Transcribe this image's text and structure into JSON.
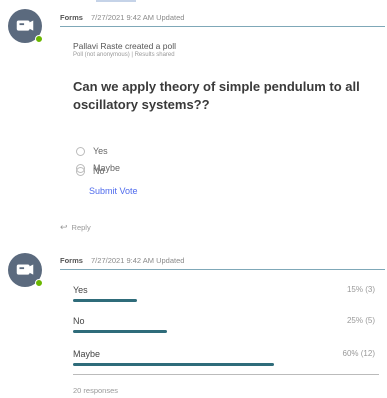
{
  "message1": {
    "app": "Forms",
    "timestamp": "7/27/2021 9:42 AM",
    "status": "Updated",
    "creator_line": "Pallavi Raste created a poll",
    "settings_line": "Poll (not anonymous) | Results shared",
    "question": "Can we apply theory of simple pendulum to all oscillatory systems??",
    "options": [
      "Yes",
      "No",
      "Maybe"
    ],
    "submit_label": "Submit Vote",
    "reply_label": "Reply"
  },
  "message2": {
    "app": "Forms",
    "timestamp": "7/27/2021 9:42 AM",
    "status": "Updated",
    "results": [
      {
        "label": "Yes",
        "pct_text": "15% (3)",
        "fraction": 0.15
      },
      {
        "label": "No",
        "pct_text": "25% (5)",
        "fraction": 0.25
      },
      {
        "label": "Maybe",
        "pct_text": "60% (12)",
        "fraction": 0.6
      }
    ],
    "responses_text": "20 responses"
  },
  "colors": {
    "accent": "#4f6bed",
    "bar": "#2f6c7a",
    "presence": "#6bb700",
    "avatar": "#5b6a7e"
  },
  "icons": {
    "avatar": "forms-bot-icon",
    "reply": "reply-arrow-icon"
  }
}
